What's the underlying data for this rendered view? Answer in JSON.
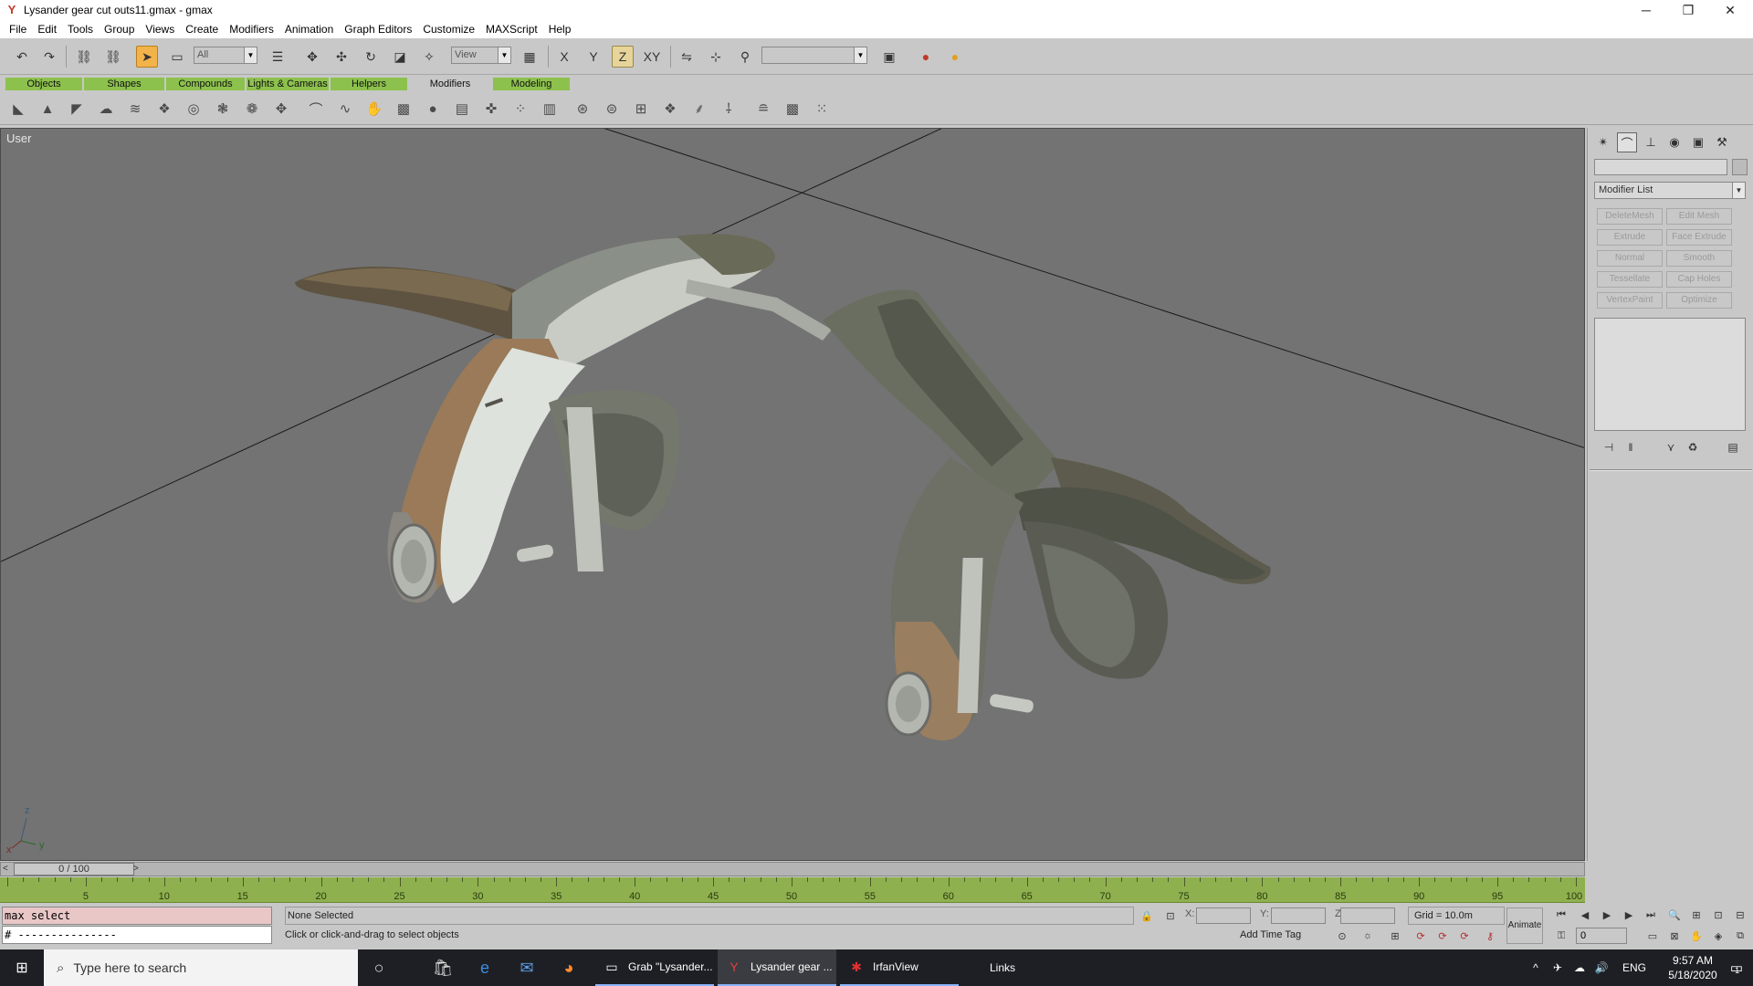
{
  "window": {
    "title": "Lysander gear cut outs11.gmax - gmax",
    "minimize": "─",
    "maximize": "❐",
    "close": "✕"
  },
  "menu": [
    "File",
    "Edit",
    "Tools",
    "Group",
    "Views",
    "Create",
    "Modifiers",
    "Animation",
    "Graph Editors",
    "Customize",
    "MAXScript",
    "Help"
  ],
  "toolbar": {
    "selection_filter": "All",
    "ref_coord": "View",
    "axis_x": "X",
    "axis_y": "Y",
    "axis_z": "Z",
    "axis_xy": "XY",
    "named_selection": ""
  },
  "tabs": [
    "Objects",
    "Shapes",
    "Compounds",
    "Lights & Cameras",
    "Helpers",
    "Modifiers",
    "Modeling"
  ],
  "active_tab": "Modifiers",
  "viewport": {
    "label": "User",
    "axis_z": "z",
    "axis_x": "x",
    "axis_y": "y"
  },
  "command_panel": {
    "modifier_list": "Modifier List",
    "modifier_buttons": [
      "DeleteMesh",
      "Edit Mesh",
      "Extrude",
      "Face Extrude",
      "Normal",
      "Smooth",
      "Tessellate",
      "Cap Holes",
      "VertexPaint",
      "Optimize"
    ]
  },
  "time": {
    "slider_label": "0 / 100",
    "ticks": [
      5,
      10,
      15,
      20,
      25,
      30,
      35,
      40,
      45,
      50,
      55,
      60,
      65,
      70,
      75,
      80,
      85,
      90,
      95,
      100
    ]
  },
  "status": {
    "maxscript_line1": "max select",
    "maxscript_line2": "# ---------------",
    "selection": "None Selected",
    "prompt": "Click or click-and-drag to select objects",
    "x_label": "X:",
    "y_label": "Y:",
    "z_label": "Z:",
    "grid": "Grid = 10.0m",
    "add_time_tag": "Add Time Tag",
    "animate": "Animate",
    "frame": "0"
  },
  "taskbar": {
    "search_placeholder": "Type here to search",
    "apps": [
      "Grab \"Lysander...",
      "Lysander gear ...",
      "IrfanView"
    ],
    "links": "Links",
    "lang": "ENG",
    "time": "9:57 AM",
    "date": "5/18/2020",
    "notification_count": "1"
  },
  "colors": {
    "tab_green": "#8dc14d",
    "viewport_bg": "#737373",
    "track_green": "#8fb04e",
    "active_tool": "#f2b34a"
  }
}
